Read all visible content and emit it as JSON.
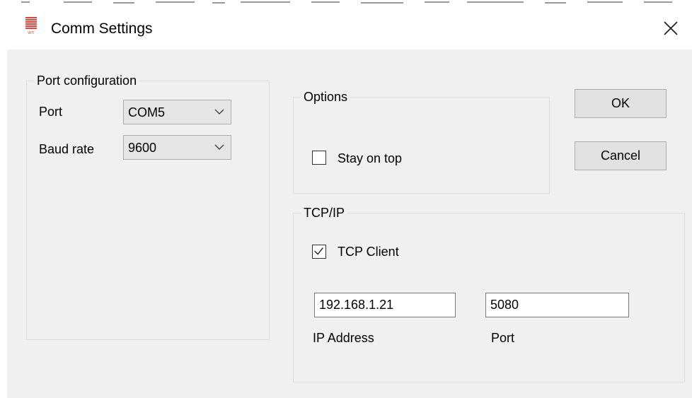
{
  "window": {
    "title": "Comm Settings",
    "icon": "wti-app-icon",
    "close_icon": "close-icon"
  },
  "port_configuration": {
    "caption": "Port configuration",
    "port_label": "Port",
    "port_value": "COM5",
    "baud_label": "Baud rate",
    "baud_value": "9600"
  },
  "options": {
    "caption": "Options",
    "stay_on_top_label": "Stay on top",
    "stay_on_top_checked": false
  },
  "tcpip": {
    "caption": "TCP/IP",
    "tcp_client_label": "TCP Client",
    "tcp_client_checked": true,
    "ip_address_value": "192.168.1.21",
    "ip_address_label": "IP Address",
    "port_value": "5080",
    "port_label": "Port"
  },
  "buttons": {
    "ok_label": "OK",
    "cancel_label": "Cancel"
  },
  "colors": {
    "background": "#f0f0f0",
    "button": "#e1e1e1",
    "icon_red": "#e8403a"
  }
}
